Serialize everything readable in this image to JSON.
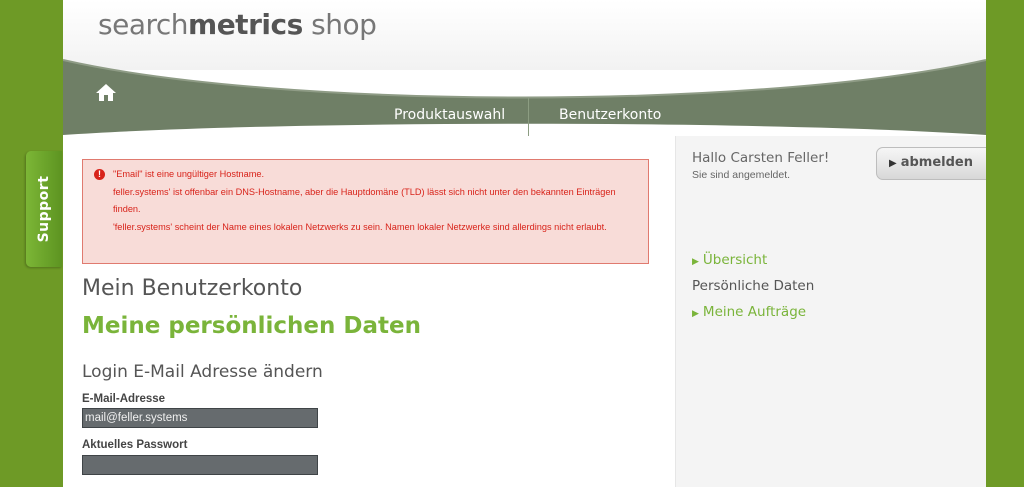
{
  "header": {
    "logo_light": "search",
    "logo_bold": "metrics",
    "logo_suffix": " shop"
  },
  "nav": {
    "items": [
      {
        "label": "Produktauswahl"
      },
      {
        "label": "Benutzerkonto"
      }
    ]
  },
  "support": {
    "label": "Support"
  },
  "errors": [
    "\"Email\" ist eine ungültiger Hostname.",
    "feller.systems' ist offenbar ein DNS-Hostname, aber die Hauptdomäne (TLD) lässt sich nicht unter den bekannten Einträgen finden.",
    "'feller.systems' scheint der Name eines lokalen Netzwerks zu sein. Namen lokaler Netzwerke sind allerdings nicht erlaubt."
  ],
  "main": {
    "title": "Mein Benutzerkonto",
    "subtitle": "Meine persönlichen Daten",
    "section_title": "Login E-Mail Adresse ändern",
    "email_label": "E-Mail-Adresse",
    "email_value": "mail@feller.systems",
    "password_label": "Aktuelles Passwort",
    "password_value": ""
  },
  "sidebar": {
    "greeting": "Hallo Carsten Feller!",
    "status": "Sie sind angemeldet.",
    "logout_label": "abmelden",
    "links": [
      {
        "label": "Übersicht",
        "active": false
      },
      {
        "label": "Persönliche Daten",
        "active": true
      },
      {
        "label": "Meine Aufträge",
        "active": false
      }
    ]
  },
  "colors": {
    "accent_green": "#7ab43a",
    "nav_band": "#6f7f66",
    "background": "#6e9a26",
    "error_red": "#d8231a"
  }
}
